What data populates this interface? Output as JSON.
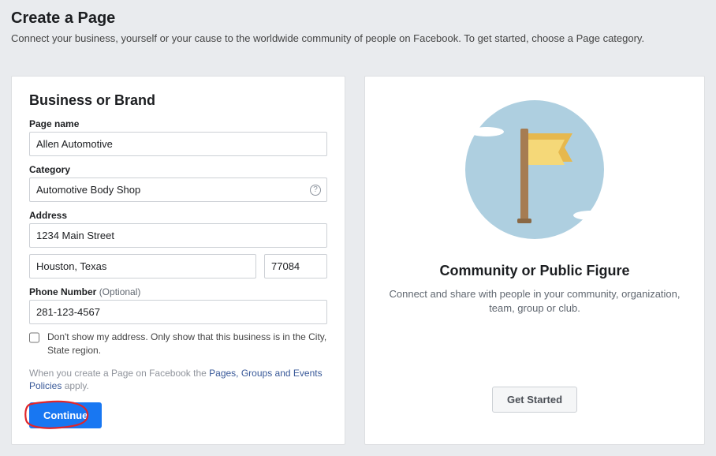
{
  "header": {
    "title": "Create a Page",
    "subtitle": "Connect your business, yourself or your cause to the worldwide community of people on Facebook. To get started, choose a Page category."
  },
  "left": {
    "heading": "Business or Brand",
    "page_name_label": "Page name",
    "page_name_value": "Allen Automotive",
    "category_label": "Category",
    "category_value": "Automotive Body Shop",
    "address_label": "Address",
    "street_value": "1234 Main Street",
    "city_value": "Houston, Texas",
    "zip_value": "77084",
    "phone_label": "Phone Number ",
    "phone_optional": "(Optional)",
    "phone_value": "281-123-4567",
    "checkbox_label": "Don't show my address. Only show that this business is in the City, State region.",
    "policy_before": "When you create a Page on Facebook the ",
    "policy_link": "Pages, Groups and Events Policies",
    "policy_after": " apply.",
    "continue_label": "Continue"
  },
  "right": {
    "heading": "Community or Public Figure",
    "description": "Connect and share with people in your community, organization, team, group or club.",
    "get_started_label": "Get Started"
  }
}
